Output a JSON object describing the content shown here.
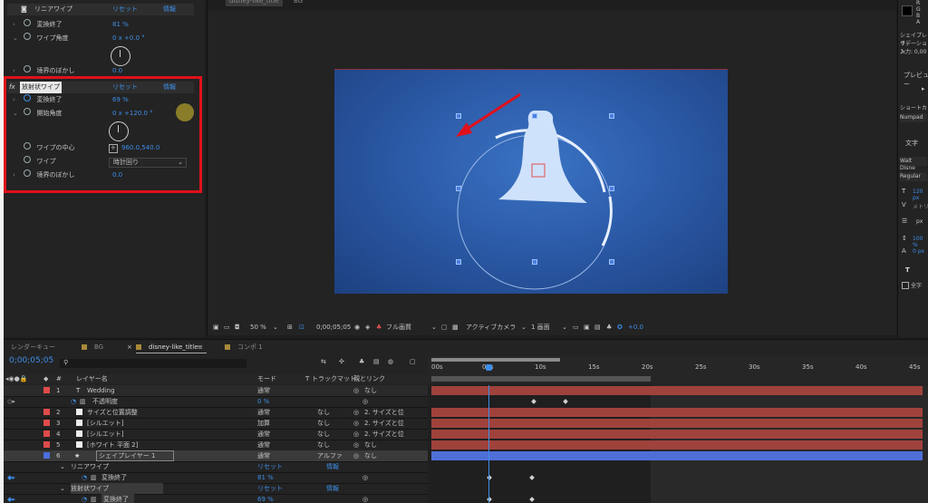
{
  "effects": {
    "linear_wipe": {
      "title": "リニアワイプ",
      "reset": "リセット",
      "info": "情報",
      "params": [
        {
          "label": "変換終了",
          "value": "81 %"
        },
        {
          "label": "ワイプ角度",
          "value": "0 x +0.0 °"
        },
        {
          "label": "境界のぼかし",
          "value": "0.0"
        }
      ]
    },
    "radial_wipe": {
      "fx": "fx",
      "title": "放射状ワイプ",
      "reset": "リセット",
      "info": "情報",
      "params": [
        {
          "label": "変換終了",
          "value": "69 %"
        },
        {
          "label": "開始角度",
          "value": "0 x +120.0 °"
        },
        {
          "label": "ワイプの中心",
          "value": "960.0,540.0"
        },
        {
          "label": "ワイプ",
          "value": "時計回り"
        },
        {
          "label": "境界のぼかし",
          "value": "0.0"
        }
      ]
    }
  },
  "composition": {
    "top_tab": "disney-like_title",
    "top_tab2": "BG"
  },
  "viewer_toolbar": {
    "zoom": "50 %",
    "timecode": "0;00;05;05",
    "quality": "フル画質",
    "camera": "アクティブカメラ",
    "views": "1 画面",
    "exposure": "+0.0"
  },
  "right_panel": {
    "color_letters": [
      "R",
      "G",
      "B",
      "A"
    ],
    "shape_lines": [
      "シェイプレイ",
      "ラデーション",
      "入力: 0,00"
    ],
    "preview": "プレビュー",
    "shortcut": "ショートカ",
    "numpad": "Numpad",
    "char_tab": "文字",
    "font": "Walt Disne",
    "style": "Regular",
    "size": "120 px",
    "kerning": "メトリ",
    "leading": "px",
    "vscale": "100 %",
    "baseline": "0 px",
    "t_icon": "T",
    "allcaps": "全字"
  },
  "tabs": [
    {
      "label": "レンダーキュー"
    },
    {
      "label": "BG"
    },
    {
      "label": "disney-like_title"
    },
    {
      "label": "コンポ 1"
    }
  ],
  "timeline": {
    "timecode": "0;00;05;05",
    "search_placeholder": "",
    "headers": {
      "layer_name": "レイヤー名",
      "mode": "モード",
      "t": "T",
      "trackmatte": "トラックマット",
      "parent": "親とリンク"
    },
    "ruler": [
      "00s",
      "05s",
      "10s",
      "15s",
      "20s",
      "25s",
      "30s",
      "35s",
      "40s",
      "45s"
    ],
    "layers": [
      {
        "num": "1",
        "name": "Wedding",
        "mode": "通常",
        "tm": "",
        "parent": "なし",
        "color": "#e04a4a"
      },
      {
        "num": "",
        "name": "不透明度",
        "mode": "",
        "tm": "",
        "parent": "",
        "color": "",
        "value": "0 %"
      },
      {
        "num": "2",
        "name": "サイズと位置調整",
        "mode": "通常",
        "tm": "なし",
        "parent": "2. サイズと位",
        "color": "#e04a4a"
      },
      {
        "num": "3",
        "name": "[シルエット]",
        "mode": "加算",
        "tm": "なし",
        "parent": "2. サイズと位",
        "color": "#e04a4a"
      },
      {
        "num": "4",
        "name": "[シルエット]",
        "mode": "通常",
        "tm": "なし",
        "parent": "2. サイズと位",
        "color": "#e04a4a"
      },
      {
        "num": "5",
        "name": "[ホワイト 平面 2]",
        "mode": "通常",
        "tm": "なし",
        "parent": "なし",
        "color": "#e04a4a"
      },
      {
        "num": "6",
        "name": "シェイプレイヤー 1",
        "mode": "通常",
        "tm": "アルファ",
        "parent": "なし",
        "color": "#4a6fe0"
      },
      {
        "num": "",
        "name": "リニアワイプ",
        "mode": "リセット",
        "tm": "情報",
        "parent": "",
        "color": ""
      },
      {
        "num": "",
        "name": "変換終了",
        "mode": "",
        "tm": "",
        "parent": "",
        "color": "",
        "value": "81 %"
      },
      {
        "num": "",
        "name": "放射状ワイプ",
        "mode": "リセット",
        "tm": "情報",
        "parent": "",
        "color": ""
      },
      {
        "num": "",
        "name": "変換終了",
        "mode": "",
        "tm": "",
        "parent": "",
        "color": "",
        "value": "69 %"
      }
    ]
  },
  "colors": {
    "canvas_blue": "#2c5ba8",
    "accent_blue": "#3d8ee8",
    "highlight_red": "#e0101a",
    "bar_red": "#a0423c",
    "bar_blue": "#4f6fd8"
  }
}
